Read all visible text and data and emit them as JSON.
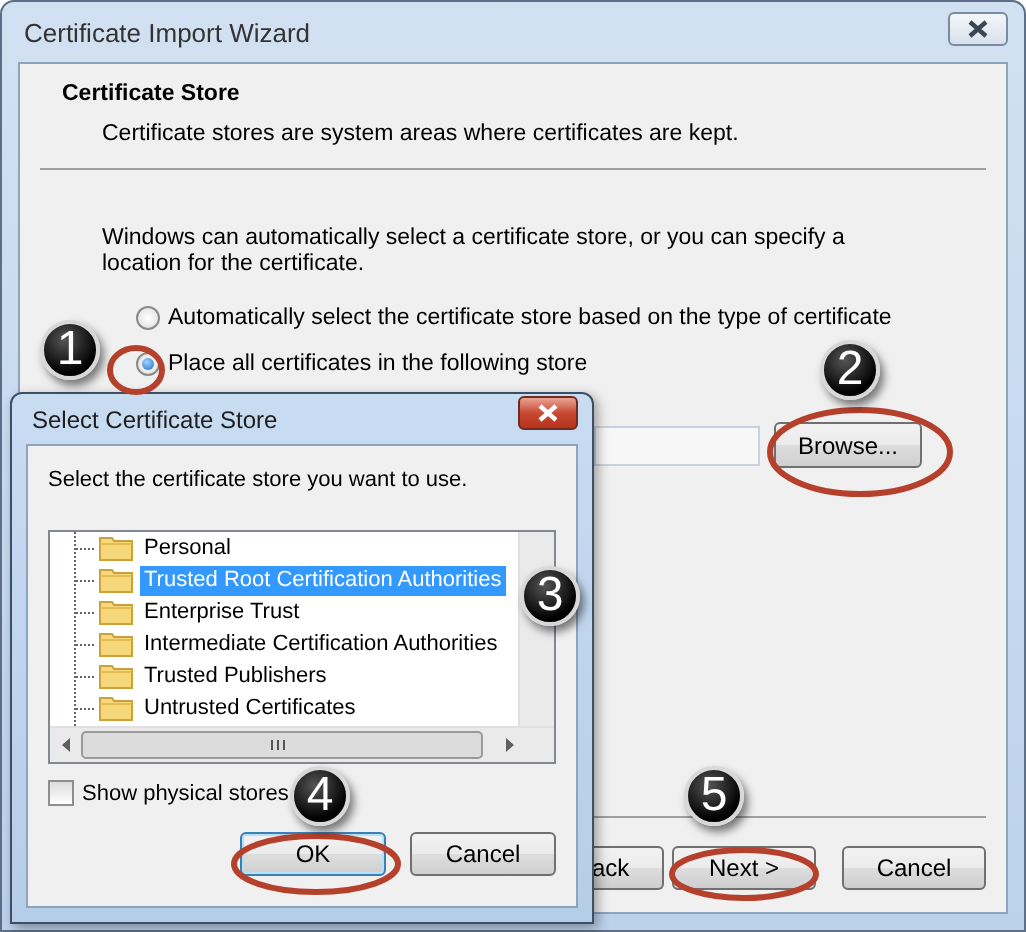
{
  "window": {
    "title": "Certificate Import Wizard"
  },
  "header": {
    "title": "Certificate Store",
    "description": "Certificate stores are system areas where certificates are kept."
  },
  "intro": "Windows can automatically select a certificate store, or you can specify a location for the certificate.",
  "store_options": [
    {
      "label": "Automatically select the certificate store based on the type of certificate",
      "selected": false
    },
    {
      "label": "Place all certificates in the following store",
      "selected": true
    }
  ],
  "browse_button": "Browse...",
  "buttons": [
    "ack",
    "Next >",
    "Cancel"
  ],
  "dialog": {
    "title": "Select Certificate Store",
    "prompt": "Select the certificate store you want to use.",
    "stores": [
      {
        "label": "Personal",
        "selected": false
      },
      {
        "label": "Trusted Root Certification Authorities",
        "selected": true
      },
      {
        "label": "Enterprise Trust",
        "selected": false
      },
      {
        "label": "Intermediate Certification Authorities",
        "selected": false
      },
      {
        "label": "Trusted Publishers",
        "selected": false
      },
      {
        "label": "Untrusted Certificates",
        "selected": false
      }
    ],
    "show_physical": {
      "label": "Show physical stores",
      "checked": false
    },
    "buttons": [
      "OK",
      "Cancel"
    ]
  },
  "callouts": [
    "1",
    "2",
    "3",
    "4",
    "5"
  ]
}
